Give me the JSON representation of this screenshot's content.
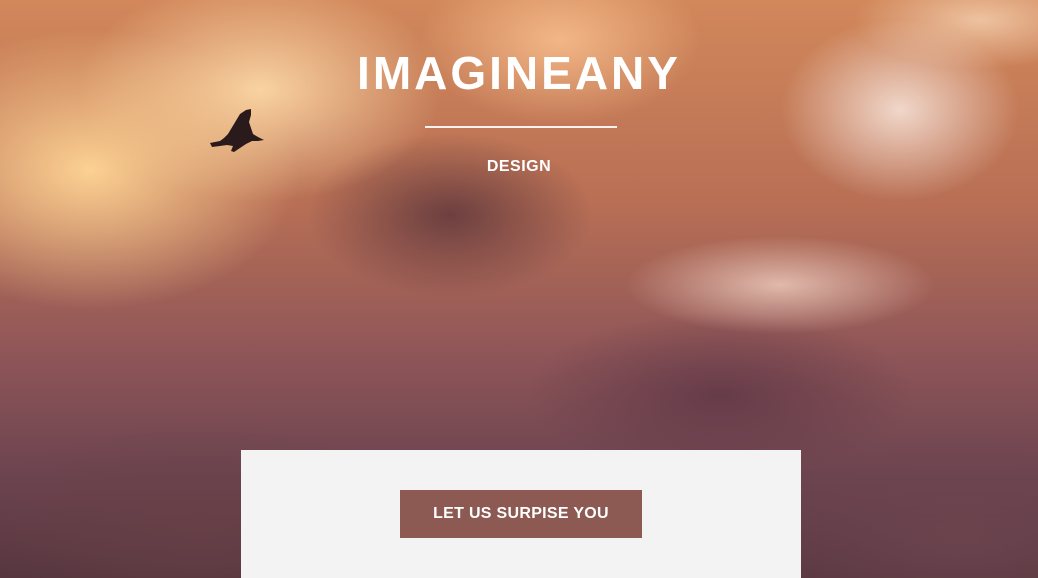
{
  "hero": {
    "title": "IMAGINEANY",
    "subtitle": "DESIGN"
  },
  "cta": {
    "button_label": "LET US SURPISE YOU"
  },
  "icons": {
    "bird": "bird-silhouette"
  },
  "colors": {
    "button_background": "#8c5a52",
    "panel_background": "#f4f3f3",
    "text": "#ffffff"
  }
}
